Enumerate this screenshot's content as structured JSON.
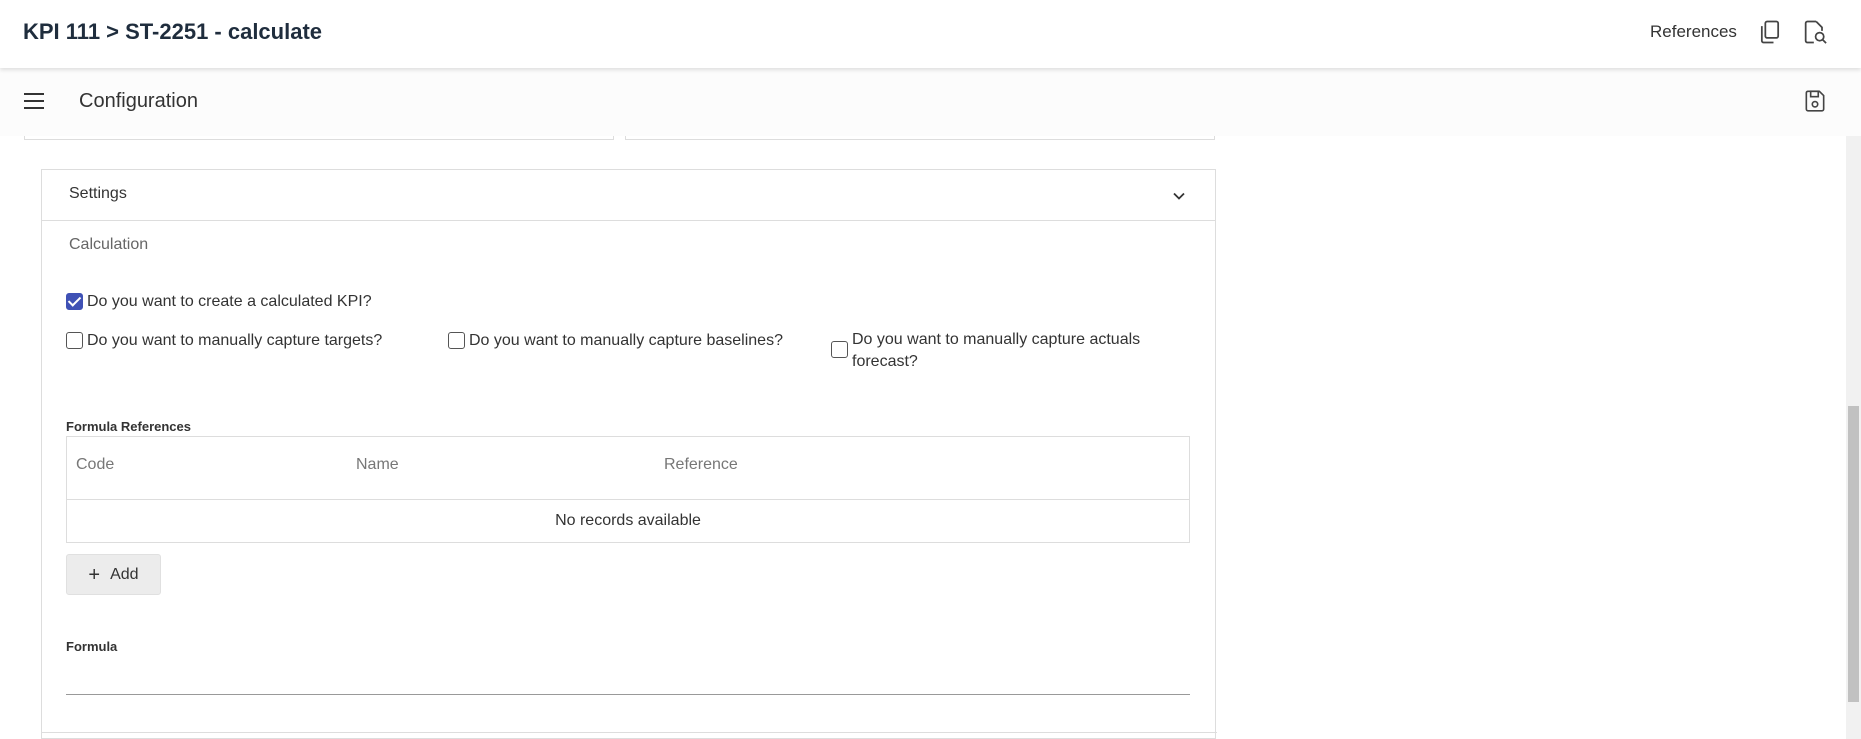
{
  "header": {
    "title": "KPI 111 > ST-2251 - calculate",
    "references_label": "References"
  },
  "subheader": {
    "title": "Configuration"
  },
  "settings": {
    "title": "Settings",
    "calculation_title": "Calculation",
    "checkboxes": [
      {
        "label": "Do you want to create a calculated KPI?",
        "checked": true
      },
      {
        "label": "Do you want to manually capture targets?",
        "checked": false
      },
      {
        "label": "Do you want to manually capture baselines?",
        "checked": false
      },
      {
        "label": "Do you want to manually capture actuals forecast?",
        "checked": false
      }
    ],
    "formula_references": {
      "label": "Formula References",
      "columns": [
        "Code",
        "Name",
        "Reference"
      ],
      "empty_text": "No records available",
      "add_label": "Add"
    },
    "formula": {
      "label": "Formula",
      "value": ""
    }
  },
  "colors": {
    "accent": "#3f51b5",
    "title": "#1f2d3d"
  }
}
